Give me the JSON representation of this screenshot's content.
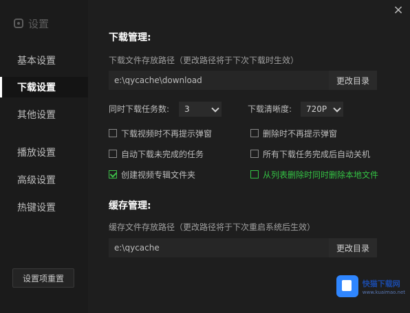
{
  "window": {
    "title": "设置",
    "close_icon": "×"
  },
  "sidebar": {
    "items": [
      {
        "label": "基本设置"
      },
      {
        "label": "下载设置",
        "active": true
      },
      {
        "label": "其他设置"
      },
      {
        "label": "播放设置"
      },
      {
        "label": "高级设置"
      },
      {
        "label": "热键设置"
      }
    ],
    "reset_label": "设置项重置"
  },
  "download": {
    "title": "下载管理:",
    "path_hint": "下载文件存放路径（更改路径将于下次下载时生效）",
    "path_value": "e:\\qycache\\download",
    "change_label": "更改目录",
    "tasks_label": "同时下载任务数:",
    "tasks_value": "3",
    "quality_label": "下载清晰度:",
    "quality_value": "720P",
    "options": [
      {
        "label": "下载视频时不再提示弹窗",
        "checked": false
      },
      {
        "label": "删除时不再提示弹窗",
        "checked": false
      },
      {
        "label": "自动下载未完成的任务",
        "checked": false
      },
      {
        "label": "所有下载任务完成后自动关机",
        "checked": false
      },
      {
        "label": "创建视频专辑文件夹",
        "checked": true
      },
      {
        "label": "从列表删除时同时删除本地文件",
        "checked": false,
        "highlight": true
      }
    ]
  },
  "cache": {
    "title": "缓存管理:",
    "path_hint": "缓存文件存放路径（更改路径将于下次重启系统后生效）",
    "path_value": "e:\\qycache",
    "change_label": "更改目录"
  },
  "watermark": {
    "main": "快猫下载网",
    "sub": "www.kuaimao.net"
  },
  "colors": {
    "background": "#1e1e1e",
    "sidebar": "#1b1b1b",
    "accent_green": "#34c244",
    "text": "#c8c8c8"
  }
}
